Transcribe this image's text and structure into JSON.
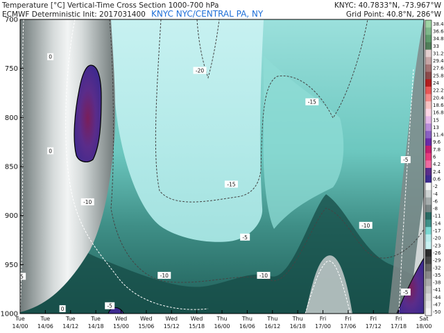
{
  "header": {
    "line1": "Temperature [°C] Vertical-Time Cross Section 1000-700 hPa",
    "line2": "ECMWF Deterministic Init: 2017031400",
    "station": "KNYC NYC/CENTRAL PA, NY",
    "right1": "KNYC: 40.7833°N, -73.967°W",
    "right2": "Grid Point: 40.8°N, 286°W"
  },
  "colors": {
    "zero_contour": "#000000",
    "neg5_contour": "#ffffff",
    "other_contours": "#444444",
    "cold_core": "#b8ecec",
    "cold_mid": "#7ad8d2",
    "teal": "#3f8f87",
    "dark_teal": "#0f4a44",
    "gray": "#9ea8a6",
    "light_gray": "#e8ecec",
    "purple": "#6a2aa8"
  },
  "chart_data": {
    "type": "heatmap",
    "title": "Temperature [°C] Vertical-Time Cross Section 1000-700 hPa",
    "xlabel": "",
    "ylabel": "",
    "y_axis": {
      "ticks": [
        "700",
        "750",
        "800",
        "850",
        "900",
        "950",
        "1000"
      ],
      "range": [
        700,
        1000
      ],
      "inverted": true
    },
    "x_axis": {
      "ticks": [
        {
          "day": "Tue",
          "time": "14/00"
        },
        {
          "day": "Tue",
          "time": "14/06"
        },
        {
          "day": "Tue",
          "time": "14/12"
        },
        {
          "day": "Tue",
          "time": "14/18"
        },
        {
          "day": "Wed",
          "time": "15/00"
        },
        {
          "day": "Wed",
          "time": "15/06"
        },
        {
          "day": "Wed",
          "time": "15/12"
        },
        {
          "day": "Wed",
          "time": "15/18"
        },
        {
          "day": "Thu",
          "time": "16/00"
        },
        {
          "day": "Thu",
          "time": "16/06"
        },
        {
          "day": "Thu",
          "time": "16/12"
        },
        {
          "day": "Thu",
          "time": "16/18"
        },
        {
          "day": "Fri",
          "time": "17/00"
        },
        {
          "day": "Fri",
          "time": "17/06"
        },
        {
          "day": "Fri",
          "time": "17/12"
        },
        {
          "day": "Fri",
          "time": "17/18"
        },
        {
          "day": "Sat",
          "time": "18/00"
        }
      ]
    },
    "colorbar": [
      {
        "v": "38.4",
        "c": "#9fd4a4"
      },
      {
        "v": "36.6",
        "c": "#7fb88a"
      },
      {
        "v": "34.8",
        "c": "#5e9a6b"
      },
      {
        "v": "33",
        "c": "#4f7d58"
      },
      {
        "v": "31.2",
        "c": "#e3cfcf"
      },
      {
        "v": "29.4",
        "c": "#c6a6a6"
      },
      {
        "v": "27.6",
        "c": "#a37474"
      },
      {
        "v": "25.8",
        "c": "#8a4a4a"
      },
      {
        "v": "24",
        "c": "#b21e1e"
      },
      {
        "v": "22.2",
        "c": "#e85656"
      },
      {
        "v": "20.4",
        "c": "#f48a8a"
      },
      {
        "v": "18.6",
        "c": "#f9c2c2"
      },
      {
        "v": "16.8",
        "c": "#ffd7e6"
      },
      {
        "v": "15",
        "c": "#e6b9e9"
      },
      {
        "v": "13",
        "c": "#b98cd8"
      },
      {
        "v": "11.4",
        "c": "#8a5fc2"
      },
      {
        "v": "9.6",
        "c": "#6a2aa8"
      },
      {
        "v": "7.8",
        "c": "#c21e6e"
      },
      {
        "v": "6",
        "c": "#e63a7c"
      },
      {
        "v": "4.2",
        "c": "#f06aa0"
      },
      {
        "v": "2.4",
        "c": "#5a2c8a"
      },
      {
        "v": "0.6",
        "c": "#3d2a8f"
      },
      {
        "v": "-2",
        "c": "#f4f4f4"
      },
      {
        "v": "-4",
        "c": "#cfd4d4"
      },
      {
        "v": "-6",
        "c": "#a6adad"
      },
      {
        "v": "-8",
        "c": "#7a8585"
      },
      {
        "v": "-11",
        "c": "#2a6a63"
      },
      {
        "v": "-14",
        "c": "#3f8f87"
      },
      {
        "v": "-17",
        "c": "#7ad8d2"
      },
      {
        "v": "-20",
        "c": "#b8ecec"
      },
      {
        "v": "-23",
        "c": "#c9f2f2"
      },
      {
        "v": "-26",
        "c": "#2a2a2a"
      },
      {
        "v": "-29",
        "c": "#444444"
      },
      {
        "v": "-32",
        "c": "#666666"
      },
      {
        "v": "-35",
        "c": "#888888"
      },
      {
        "v": "-38",
        "c": "#aaaaaa"
      },
      {
        "v": "-41",
        "c": "#c4c4c4"
      },
      {
        "v": "-44",
        "c": "#d8d8d8"
      },
      {
        "v": "-47",
        "c": "#e8e8e8"
      },
      {
        "v": "-50",
        "c": "#f6f6f6"
      }
    ],
    "contour_labels": [
      {
        "text": "0",
        "t": 0.075,
        "p": 738
      },
      {
        "text": "0",
        "t": 0.075,
        "p": 834
      },
      {
        "text": "0",
        "t": 0.105,
        "p": 995
      },
      {
        "text": "-5",
        "t": 0.002,
        "p": 962
      },
      {
        "text": "-5",
        "t": 0.222,
        "p": 992
      },
      {
        "text": "-5",
        "t": 0.557,
        "p": 922
      },
      {
        "text": "-5",
        "t": 0.955,
        "p": 843
      },
      {
        "text": "-5",
        "t": 0.955,
        "p": 978
      },
      {
        "text": "-10",
        "t": 0.167,
        "p": 886
      },
      {
        "text": "-10",
        "t": 0.357,
        "p": 961
      },
      {
        "text": "-10",
        "t": 0.603,
        "p": 961
      },
      {
        "text": "-10",
        "t": 0.856,
        "p": 910
      },
      {
        "text": "-15",
        "t": 0.523,
        "p": 868
      },
      {
        "text": "-15",
        "t": 0.723,
        "p": 784
      },
      {
        "text": "-20",
        "t": 0.445,
        "p": 752
      }
    ]
  }
}
